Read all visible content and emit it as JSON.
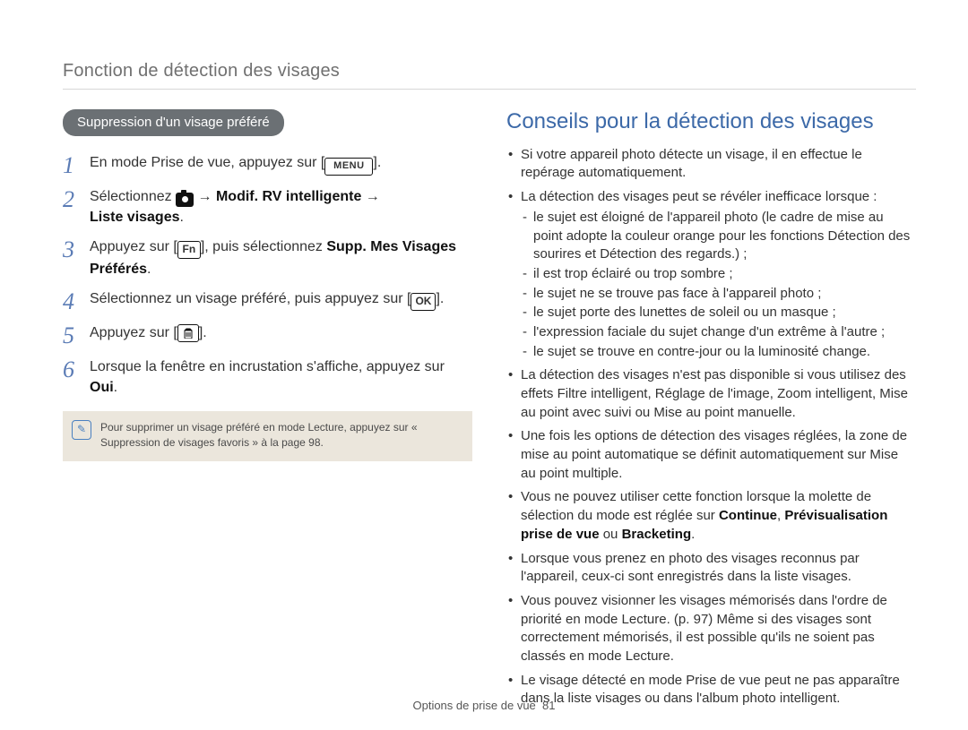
{
  "header": "Fonction de détection des visages",
  "left": {
    "pill": "Suppression d'un visage préféré",
    "steps": [
      {
        "num": "1",
        "pre": "En mode Prise de vue, appuyez sur [",
        "icon_label": "MENU",
        "post": "]."
      },
      {
        "num": "2",
        "pre": "Sélectionnez ",
        "after_icon": " ",
        "bold": "Modif. RV intelligente",
        "bold2": "Liste visages",
        "post": "."
      },
      {
        "num": "3",
        "pre": "Appuyez sur [",
        "fn": "Fn",
        "mid": "], puis sélectionnez ",
        "bold": "Supp. Mes Visages Préférés",
        "post": "."
      },
      {
        "num": "4",
        "pre": "Sélectionnez un visage préféré, puis appuyez sur [",
        "ok": "OK",
        "post": "]."
      },
      {
        "num": "5",
        "pre": "Appuyez sur [",
        "post": "]."
      },
      {
        "num": "6",
        "pre": "Lorsque la fenêtre en incrustation s'affiche, appuyez sur ",
        "bold": "Oui",
        "post": "."
      }
    ],
    "note_icon": "✎",
    "note": "Pour supprimer un visage préféré en mode Lecture, appuyez sur « Suppression de visages favoris » à la page 98."
  },
  "right": {
    "title": "Conseils pour la détection des visages",
    "tips": [
      {
        "text": "Si votre appareil photo détecte un visage, il en effectue le repérage automatiquement."
      },
      {
        "text": "La détection des visages peut se révéler inefficace lorsque :",
        "sub": [
          "le sujet est éloigné de l'appareil photo (le cadre de mise au point adopte la couleur orange pour les fonctions Détection des sourires et Détection des regards.) ;",
          "il est trop éclairé ou trop sombre ;",
          "le sujet ne se trouve pas face à l'appareil photo ;",
          "le sujet porte des lunettes de soleil ou un masque ;",
          "l'expression faciale du sujet change d'un extrême à l'autre ;",
          "le sujet se trouve en contre-jour ou la luminosité change."
        ]
      },
      {
        "text": "La détection des visages n'est pas disponible si vous utilisez des effets Filtre intelligent, Réglage de l'image, Zoom intelligent, Mise au point avec suivi ou Mise au point manuelle."
      },
      {
        "text": "Une fois les options de détection des visages réglées, la zone de mise au point automatique se définit automatiquement sur Mise au point multiple."
      },
      {
        "pre": "Vous ne pouvez utiliser cette fonction lorsque la molette de sélection du mode est réglée sur ",
        "b1": "Continue",
        "s1": ", ",
        "b2": "Prévisualisation prise de vue",
        "s2": " ou ",
        "b3": "Bracketing",
        "post": "."
      },
      {
        "text": "Lorsque vous prenez en photo des visages reconnus par l'appareil, ceux-ci sont enregistrés dans la liste visages."
      },
      {
        "text": "Vous pouvez visionner les visages mémorisés dans l'ordre de priorité en mode Lecture. (p. 97) Même si des visages sont correctement mémorisés, il est possible qu'ils ne soient pas classés en mode Lecture."
      },
      {
        "text": "Le visage détecté en mode Prise de vue peut ne pas apparaître dans la liste visages ou dans l'album photo intelligent."
      }
    ]
  },
  "footer": {
    "section": "Options de prise de vue",
    "page": "81"
  }
}
